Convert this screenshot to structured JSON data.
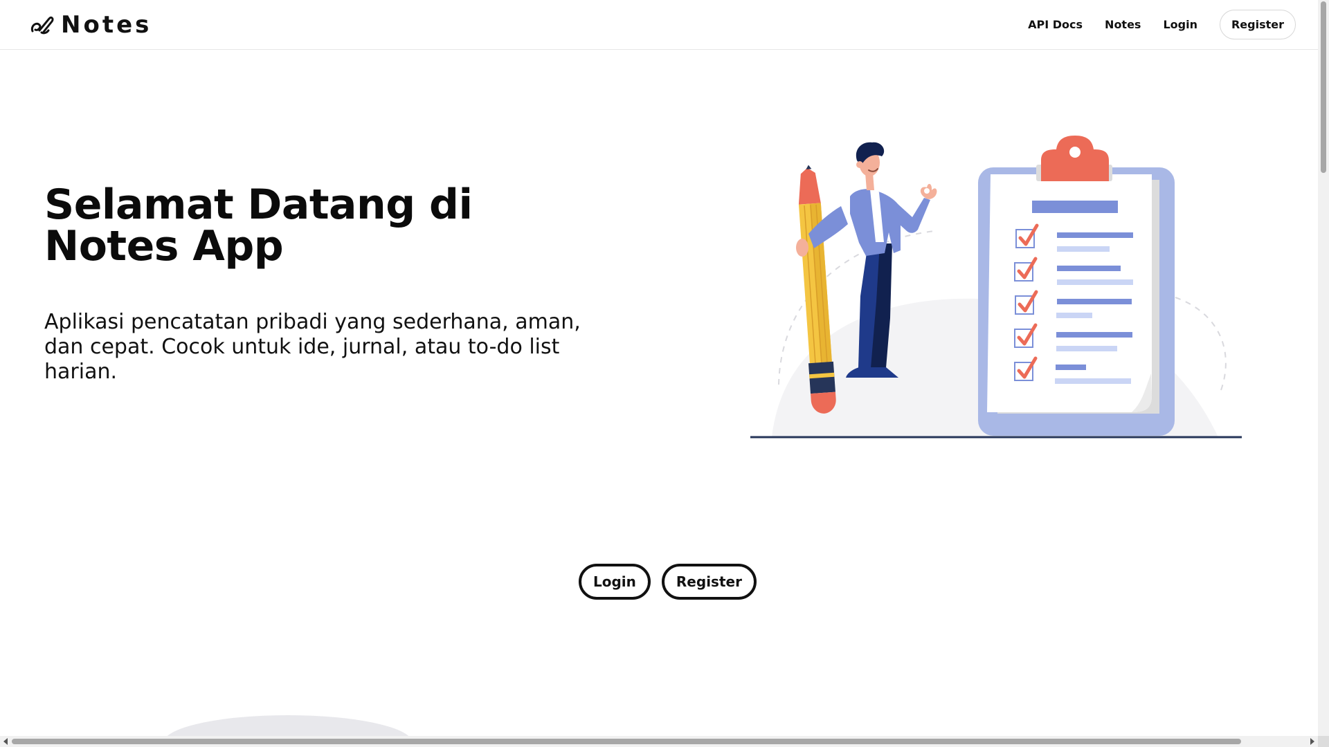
{
  "header": {
    "brand_name": "Notes",
    "brand_icon": "link-icon",
    "nav": {
      "api_docs": "API Docs",
      "notes": "Notes",
      "login": "Login",
      "register": "Register"
    }
  },
  "hero": {
    "title": "Selamat Datang di Notes App",
    "subtitle": "Aplikasi pencatatan pribadi yang sederhana, aman, dan cepat. Cocok untuk ide, jurnal, atau to-do list harian.",
    "illustration": "person-with-pencil-and-checklist-illustration"
  },
  "cta": {
    "login": "Login",
    "register": "Register"
  },
  "colors": {
    "text": "#111111",
    "border": "#e6e6e6",
    "accent_blue": "#7b8fd8",
    "accent_red": "#ec6b57",
    "pencil_yellow": "#f4c542"
  }
}
